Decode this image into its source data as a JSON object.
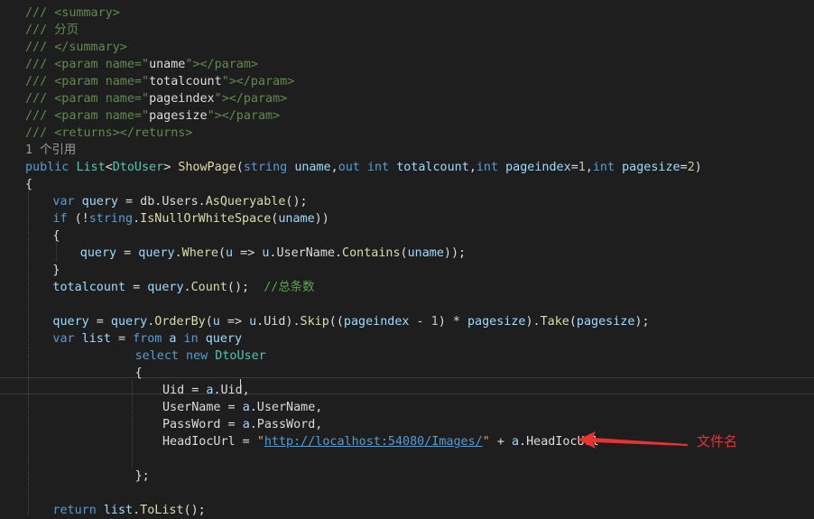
{
  "code": {
    "doc": [
      "/// <summary>",
      "/// 分页",
      "/// </summary>",
      "/// <param name=\"uname\"></param>",
      "/// <param name=\"totalcount\"></param>",
      "/// <param name=\"pageindex\"></param>",
      "/// <param name=\"pagesize\"></param>",
      "/// <returns></returns>"
    ],
    "reference_count": "1 个引用",
    "signature": [
      {
        "t": "public ",
        "c": "kw"
      },
      {
        "t": "List",
        "c": "ty"
      },
      {
        "t": "<",
        "c": "pl"
      },
      {
        "t": "DtoUser",
        "c": "ty"
      },
      {
        "t": "> ",
        "c": "pl"
      },
      {
        "t": "ShowPage",
        "c": "fn"
      },
      {
        "t": "(",
        "c": "pl"
      },
      {
        "t": "string ",
        "c": "kw"
      },
      {
        "t": "uname",
        "c": "pa"
      },
      {
        "t": ",",
        "c": "pl"
      },
      {
        "t": "out ",
        "c": "kw"
      },
      {
        "t": "int ",
        "c": "kw"
      },
      {
        "t": "totalcount",
        "c": "pa"
      },
      {
        "t": ",",
        "c": "pl"
      },
      {
        "t": "int ",
        "c": "kw"
      },
      {
        "t": "pageindex",
        "c": "pa"
      },
      {
        "t": "=",
        "c": "pl"
      },
      {
        "t": "1",
        "c": "nm"
      },
      {
        "t": ",",
        "c": "pl"
      },
      {
        "t": "int ",
        "c": "kw"
      },
      {
        "t": "pagesize",
        "c": "pa"
      },
      {
        "t": "=",
        "c": "pl"
      },
      {
        "t": "2",
        "c": "nm"
      },
      {
        "t": ")",
        "c": "pl"
      }
    ],
    "body": [
      {
        "row": 10,
        "indent": "",
        "tokens": [
          {
            "t": "{",
            "c": "pl"
          }
        ]
      },
      {
        "row": 11,
        "indent": "    ",
        "tokens": [
          {
            "t": "var ",
            "c": "kw"
          },
          {
            "t": "query",
            "c": "pa"
          },
          {
            "t": " = db.Users.",
            "c": "pl"
          },
          {
            "t": "AsQueryable",
            "c": "fn"
          },
          {
            "t": "();",
            "c": "pl"
          }
        ]
      },
      {
        "row": 12,
        "indent": "    ",
        "tokens": [
          {
            "t": "if ",
            "c": "kw"
          },
          {
            "t": "(!",
            "c": "pl"
          },
          {
            "t": "string",
            "c": "kw"
          },
          {
            "t": ".",
            "c": "pl"
          },
          {
            "t": "IsNullOrWhiteSpace",
            "c": "fn"
          },
          {
            "t": "(",
            "c": "pl"
          },
          {
            "t": "uname",
            "c": "pa"
          },
          {
            "t": "))",
            "c": "pl"
          }
        ]
      },
      {
        "row": 13,
        "indent": "    ",
        "tokens": [
          {
            "t": "{",
            "c": "pl"
          }
        ]
      },
      {
        "row": 14,
        "indent": "        ",
        "tokens": [
          {
            "t": "query",
            "c": "pa"
          },
          {
            "t": " = ",
            "c": "pl"
          },
          {
            "t": "query",
            "c": "pa"
          },
          {
            "t": ".",
            "c": "pl"
          },
          {
            "t": "Where",
            "c": "fn"
          },
          {
            "t": "(",
            "c": "pl"
          },
          {
            "t": "u",
            "c": "pa"
          },
          {
            "t": " => ",
            "c": "pl"
          },
          {
            "t": "u",
            "c": "pa"
          },
          {
            "t": ".UserName.",
            "c": "pl"
          },
          {
            "t": "Contains",
            "c": "fn"
          },
          {
            "t": "(",
            "c": "pl"
          },
          {
            "t": "uname",
            "c": "pa"
          },
          {
            "t": "));",
            "c": "pl"
          }
        ]
      },
      {
        "row": 15,
        "indent": "    ",
        "tokens": [
          {
            "t": "}",
            "c": "pl"
          }
        ]
      },
      {
        "row": 16,
        "indent": "    ",
        "tokens": [
          {
            "t": "totalcount",
            "c": "pa"
          },
          {
            "t": " = ",
            "c": "pl"
          },
          {
            "t": "query",
            "c": "pa"
          },
          {
            "t": ".",
            "c": "pl"
          },
          {
            "t": "Count",
            "c": "fn"
          },
          {
            "t": "();  ",
            "c": "pl"
          },
          {
            "t": "//总条数",
            "c": "c"
          }
        ]
      },
      {
        "row": 18,
        "indent": "    ",
        "tokens": [
          {
            "t": "query",
            "c": "pa"
          },
          {
            "t": " = ",
            "c": "pl"
          },
          {
            "t": "query",
            "c": "pa"
          },
          {
            "t": ".",
            "c": "pl"
          },
          {
            "t": "OrderBy",
            "c": "fn"
          },
          {
            "t": "(",
            "c": "pl"
          },
          {
            "t": "u",
            "c": "pa"
          },
          {
            "t": " => ",
            "c": "pl"
          },
          {
            "t": "u",
            "c": "pa"
          },
          {
            "t": ".Uid).",
            "c": "pl"
          },
          {
            "t": "Skip",
            "c": "fn"
          },
          {
            "t": "((",
            "c": "pl"
          },
          {
            "t": "pageindex",
            "c": "pa"
          },
          {
            "t": " - ",
            "c": "pl"
          },
          {
            "t": "1",
            "c": "nm"
          },
          {
            "t": ") * ",
            "c": "pl"
          },
          {
            "t": "pagesize",
            "c": "pa"
          },
          {
            "t": ").",
            "c": "pl"
          },
          {
            "t": "Take",
            "c": "fn"
          },
          {
            "t": "(",
            "c": "pl"
          },
          {
            "t": "pagesize",
            "c": "pa"
          },
          {
            "t": ");",
            "c": "pl"
          }
        ]
      },
      {
        "row": 19,
        "indent": "    ",
        "tokens": [
          {
            "t": "var ",
            "c": "kw"
          },
          {
            "t": "list",
            "c": "pa"
          },
          {
            "t": " = ",
            "c": "pl"
          },
          {
            "t": "from ",
            "c": "kw"
          },
          {
            "t": "a",
            "c": "pa"
          },
          {
            "t": " in ",
            "c": "kw"
          },
          {
            "t": "query",
            "c": "pa"
          }
        ]
      },
      {
        "row": 20,
        "indent": "                ",
        "tokens": [
          {
            "t": "select new ",
            "c": "kw"
          },
          {
            "t": "DtoUser",
            "c": "ty"
          }
        ]
      },
      {
        "row": 21,
        "indent": "                ",
        "tokens": [
          {
            "t": "{",
            "c": "pl"
          }
        ]
      },
      {
        "row": 22,
        "indent": "                    ",
        "tokens": [
          {
            "t": "Uid = ",
            "c": "pl"
          },
          {
            "t": "a",
            "c": "pa"
          },
          {
            "t": ".Uid,",
            "c": "pl"
          }
        ]
      },
      {
        "row": 23,
        "indent": "                    ",
        "tokens": [
          {
            "t": "UserName = ",
            "c": "pl"
          },
          {
            "t": "a",
            "c": "pa"
          },
          {
            "t": ".UserName,",
            "c": "pl"
          }
        ]
      },
      {
        "row": 24,
        "indent": "                    ",
        "tokens": [
          {
            "t": "PassWord = ",
            "c": "pl"
          },
          {
            "t": "a",
            "c": "pa"
          },
          {
            "t": ".PassWord,",
            "c": "pl"
          }
        ]
      },
      {
        "row": 25,
        "indent": "                    ",
        "tokens": [
          {
            "t": "HeadIocUrl = ",
            "c": "pl"
          },
          {
            "t": "\"",
            "c": "st"
          },
          {
            "t": "http://localhost:54080/Images/",
            "c": "ln"
          },
          {
            "t": "\"",
            "c": "st"
          },
          {
            "t": " + ",
            "c": "pl"
          },
          {
            "t": "a",
            "c": "pa"
          },
          {
            "t": ".HeadIocUrl",
            "c": "pl"
          }
        ]
      },
      {
        "row": 27,
        "indent": "                ",
        "tokens": [
          {
            "t": "};",
            "c": "pl"
          }
        ]
      },
      {
        "row": 29,
        "indent": "    ",
        "tokens": [
          {
            "t": "return ",
            "c": "kw"
          },
          {
            "t": "list",
            "c": "pa"
          },
          {
            "t": ".",
            "c": "pl"
          },
          {
            "t": "ToList",
            "c": "fn"
          },
          {
            "t": "();",
            "c": "pl"
          }
        ]
      }
    ]
  },
  "annotation": {
    "label": "文件名",
    "color": "#e8332f"
  },
  "theme": {
    "background": "#1e1e1e",
    "comment": "#57a64a",
    "keyword": "#569cd6",
    "type": "#4ec9b0",
    "method": "#dcdcaa",
    "identifier": "#9cdcfe",
    "number": "#b5cea8",
    "string": "#d69d85"
  }
}
